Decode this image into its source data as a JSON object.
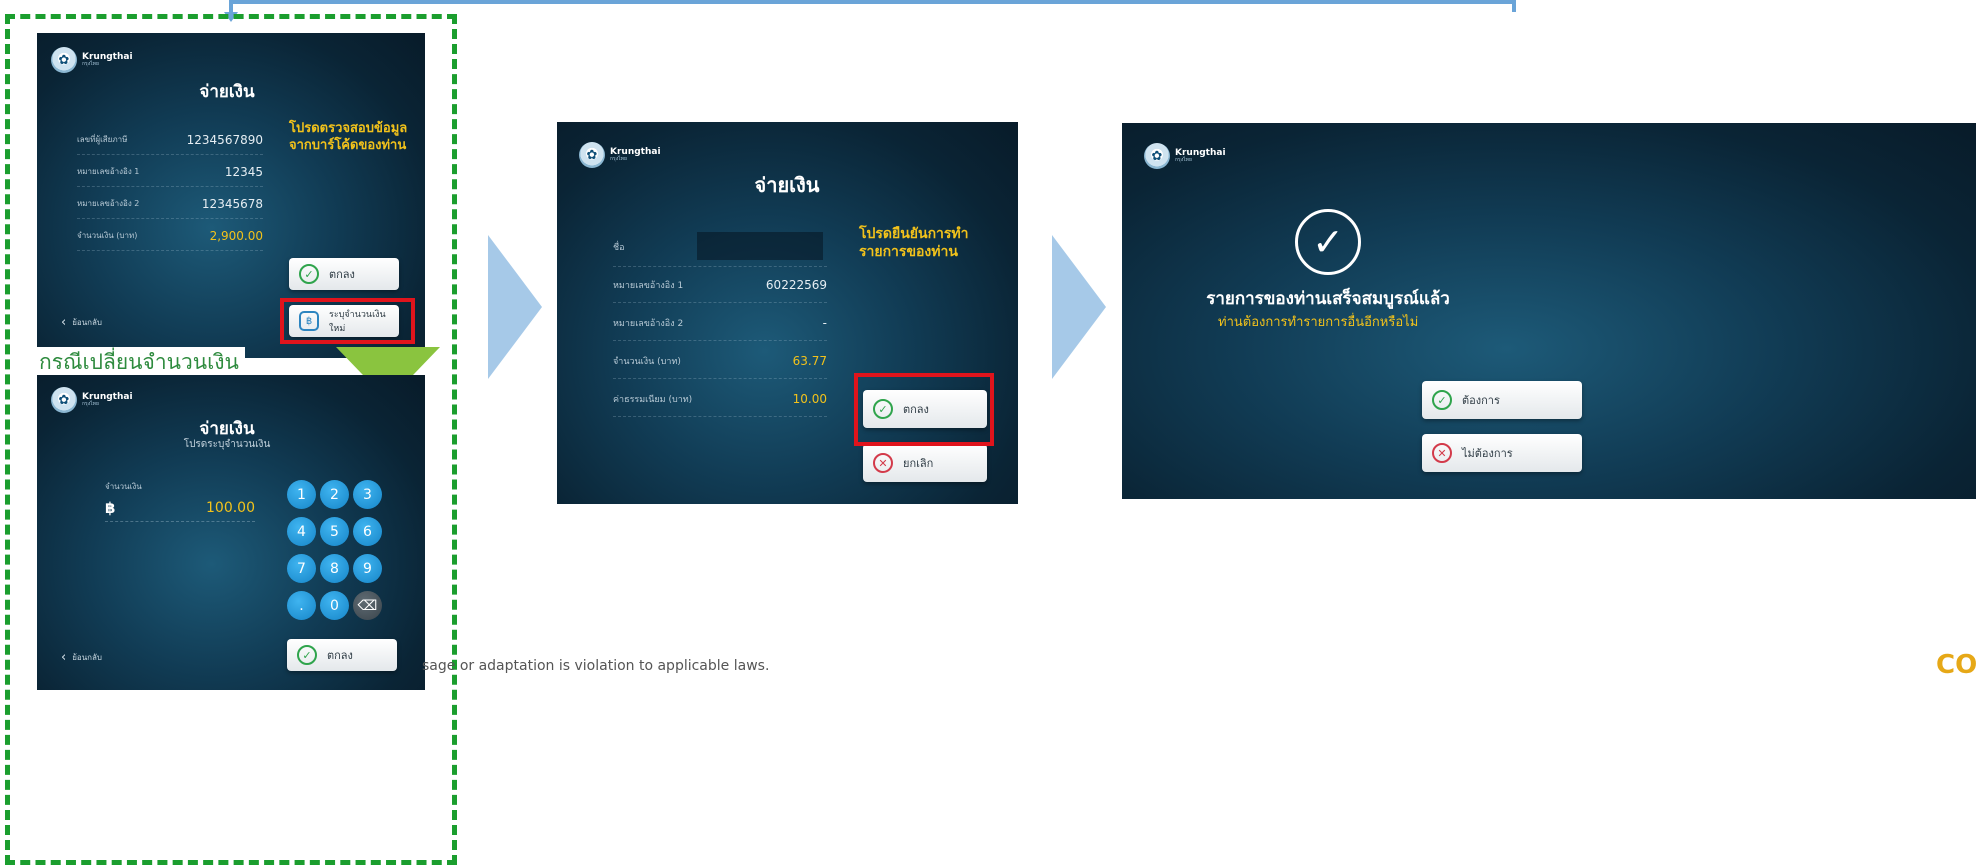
{
  "brand": {
    "name": "Krungthai",
    "sub": "กรุงไทย"
  },
  "screen1": {
    "title": "จ่ายเงิน",
    "prompt": "โปรดตรวจสอบข้อมูล จากบาร์โค้ดของท่าน",
    "rows": [
      {
        "label": "เลขที่ผู้เสียภาษี",
        "value": "1234567890"
      },
      {
        "label": "หมายเลขอ้างอิง 1",
        "value": "12345"
      },
      {
        "label": "หมายเลขอ้างอิง 2",
        "value": "12345678"
      },
      {
        "label": "จำนวนเงิน (บาท)",
        "value": "2,900.00"
      }
    ],
    "ok_label": "ตกลง",
    "new_amount_label": "ระบุจำนวนเงินใหม่",
    "back_label": "ย้อนกลับ"
  },
  "case_label": "กรณีเปลี่ยนจำนวนเงิน",
  "screen2": {
    "title": "จ่ายเงิน",
    "subtitle": "โปรดระบุจำนวนเงิน",
    "amount_label": "จำนวนเงิน",
    "currency": "฿",
    "amount": "100.00",
    "keys": [
      "1",
      "2",
      "3",
      "4",
      "5",
      "6",
      "7",
      "8",
      "9",
      ".",
      "0",
      "⌫"
    ],
    "ok_label": "ตกลง",
    "back_label": "ย้อนกลับ"
  },
  "screen3": {
    "title": "จ่ายเงิน",
    "prompt": "โปรดยืนยันการทำ รายการของท่าน",
    "rows": [
      {
        "label": "ชื่อ",
        "value": ""
      },
      {
        "label": "หมายเลขอ้างอิง 1",
        "value": "60222569"
      },
      {
        "label": "หมายเลขอ้างอิง 2",
        "value": "-"
      },
      {
        "label": "จำนวนเงิน (บาท)",
        "value": "63.77"
      },
      {
        "label": "ค่าธรรมเนียม (บาท)",
        "value": "10.00"
      }
    ],
    "ok_label": "ตกลง",
    "cancel_label": "ยกเลิก"
  },
  "screen4": {
    "success_title": "รายการของท่านเสร็จสมบูรณ์แล้ว",
    "question": "ท่านต้องการทำรายการอื่นอีกหรือไม่",
    "yes_label": "ต้องการ",
    "no_label": "ไม่ต้องการ"
  },
  "footer_text": "sage or adaptation is violation to applicable laws.",
  "corner_text": "CO",
  "colors": {
    "accent_gold": "#f2c21b",
    "highlight_red": "#e0141c",
    "dash_green": "#1b9e2e",
    "arrow_blue": "#a6c9e8"
  }
}
